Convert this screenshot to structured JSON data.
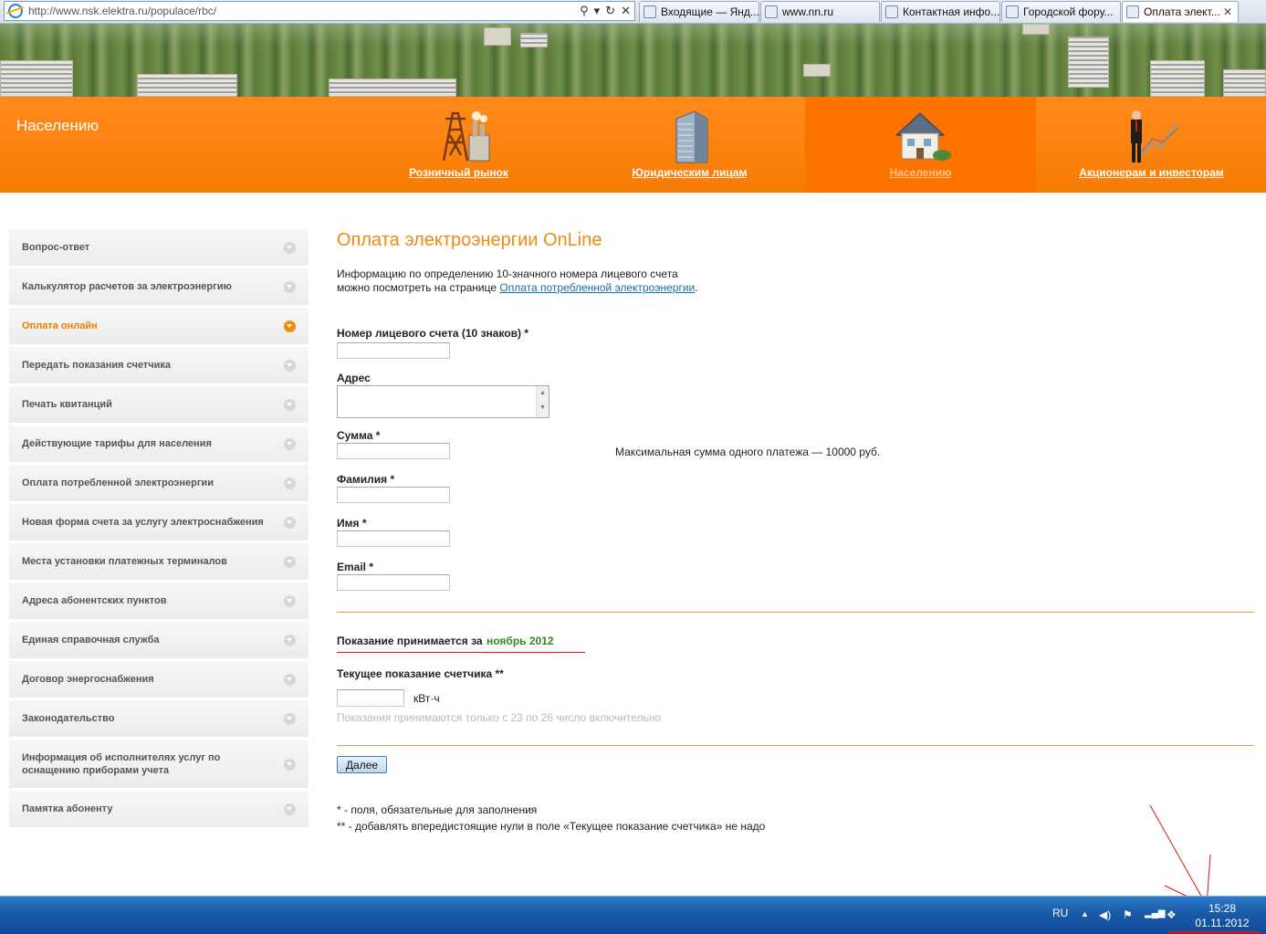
{
  "browser": {
    "url": "http://www.nsk.elektra.ru/populace/rbc/",
    "tabs": [
      {
        "label": "Входящие — Янд...",
        "active": false
      },
      {
        "label": "www.nn.ru",
        "active": false
      },
      {
        "label": "Контактная инфо...",
        "active": false
      },
      {
        "label": "Городской фору...",
        "active": false
      },
      {
        "label": "Оплата элект...",
        "active": true
      }
    ],
    "close_glyph": "✕"
  },
  "header": {
    "section_title": "Населению",
    "nav": [
      {
        "label": "Розничный рынок",
        "icon": "power-tower-icon",
        "current": false
      },
      {
        "label": "Юридическим лицам",
        "icon": "office-building-icon",
        "current": false
      },
      {
        "label": "Населению",
        "icon": "house-icon",
        "current": true
      },
      {
        "label": "Акционерам и инвесторам",
        "icon": "businessman-chart-icon",
        "current": false
      }
    ]
  },
  "sidebar": {
    "items": [
      {
        "label": "Вопрос-ответ"
      },
      {
        "label": "Калькулятор расчетов за электроэнергию"
      },
      {
        "label": "Оплата онлайн",
        "active": true
      },
      {
        "label": "Передать показания счетчика"
      },
      {
        "label": "Печать квитанций"
      },
      {
        "label": "Действующие тарифы для населения"
      },
      {
        "label": "Оплата потребленной электроэнергии"
      },
      {
        "label": "Новая форма счета за услугу электроснабжения"
      },
      {
        "label": "Места установки платежных терминалов"
      },
      {
        "label": "Адреса абонентских пунктов"
      },
      {
        "label": "Единая справочная служба"
      },
      {
        "label": "Договор энергоснабжения"
      },
      {
        "label": "Законодательство"
      },
      {
        "label": "Информация об исполнителях услуг по оснащению приборами учета"
      },
      {
        "label": "Памятка абоненту"
      }
    ]
  },
  "main": {
    "title": "Оплата электроэнергии OnLine",
    "info_line1": "Информацию по определению 10-значного номера лицевого счета",
    "info_line2": "можно посмотреть на странице",
    "info_link": "Оплата потребленной электроэнергии",
    "info_end": ".",
    "form": {
      "account_label": "Номер лицевого счета (10 знаков) *",
      "account_value": "",
      "address_label": "Адрес",
      "address_value": "",
      "sum_label": "Сумма *",
      "sum_value": "",
      "sum_note": "Максимальная сумма одного платежа — 10000 руб.",
      "lastname_label": "Фамилия *",
      "lastname_value": "",
      "firstname_label": "Имя *",
      "firstname_value": "",
      "email_label": "Email *",
      "email_value": "",
      "period_label": "Показание принимается за",
      "period_value": "ноябрь 2012",
      "meter_label": "Текущее показание счетчика **",
      "meter_value": "",
      "meter_unit": "кВт·ч",
      "meter_hint": "Показания принимаются только с 23 по 26 число включительно",
      "submit_label": "Далее"
    },
    "footnote1": "* - поля, обязательные для заполнения",
    "footnote2": "** - добавлять впередистоящие нули в поле «Текущее показание счетчика» не надо"
  },
  "taskbar": {
    "language": "RU",
    "time": "15:28",
    "date": "01.11.2012"
  },
  "colors": {
    "orange": "#f77c05",
    "title_orange": "#f08a14",
    "green": "#2e8b1e",
    "link": "#1b6fa8",
    "annotation_red": "#d11111"
  }
}
